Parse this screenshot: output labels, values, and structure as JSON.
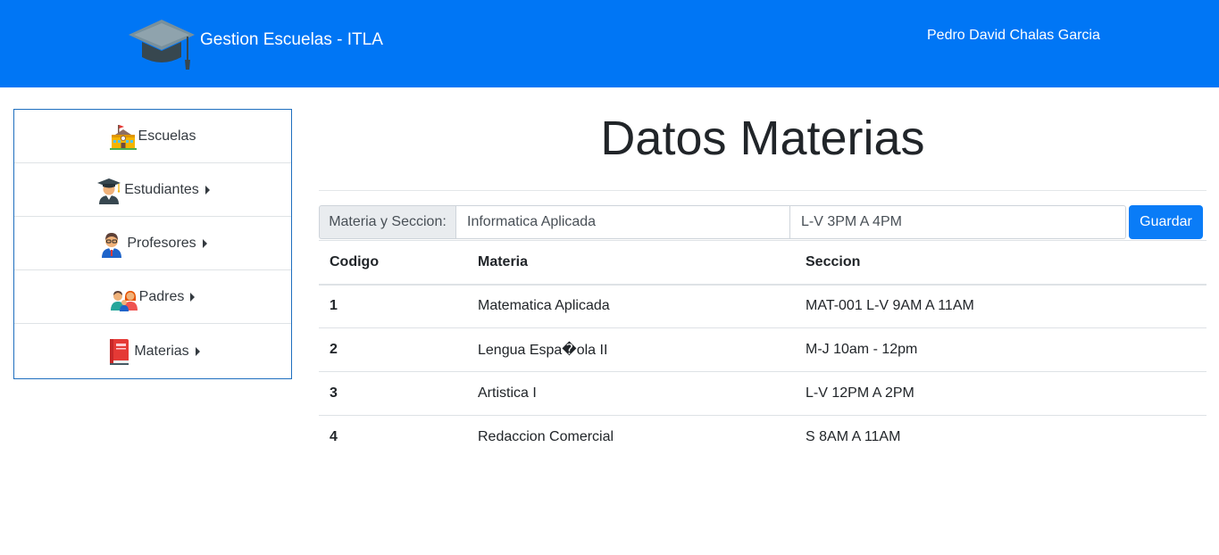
{
  "header": {
    "brand_title": "Gestion Escuelas - ITLA",
    "user_name": "Pedro David Chalas Garcia",
    "logo_icon": "graduation-cap-icon",
    "background_color": "#0076f5"
  },
  "sidebar": {
    "items": [
      {
        "label": "Escuelas",
        "icon": "school-building-icon",
        "has_submenu": false
      },
      {
        "label": "Estudiantes",
        "icon": "student-graduate-icon",
        "has_submenu": true
      },
      {
        "label": "Profesores",
        "icon": "teacher-icon",
        "has_submenu": true
      },
      {
        "label": "Padres",
        "icon": "parents-icon",
        "has_submenu": true
      },
      {
        "label": "Materias",
        "icon": "book-icon",
        "has_submenu": true
      }
    ]
  },
  "main": {
    "title": "Datos Materias",
    "form": {
      "prepend_label": "Materia y Seccion:",
      "materia_value": "Informatica Aplicada",
      "seccion_value": "L-V 3PM A 4PM",
      "save_label": "Guardar"
    },
    "table": {
      "columns": [
        "Codigo",
        "Materia",
        "Seccion"
      ],
      "rows": [
        [
          "1",
          "Matematica Aplicada",
          "MAT-001 L-V 9AM A 11AM"
        ],
        [
          "2",
          "Lengua Espa�ola II",
          "M-J 10am - 12pm"
        ],
        [
          "3",
          "Artistica I",
          "L-V 12PM A 2PM"
        ],
        [
          "4",
          "Redaccion Comercial",
          "S 8AM A 11AM"
        ]
      ]
    }
  },
  "colors": {
    "accent": "#0076f5",
    "button": "#0a7cf7",
    "sidebar_border": "#1f6fbf"
  }
}
